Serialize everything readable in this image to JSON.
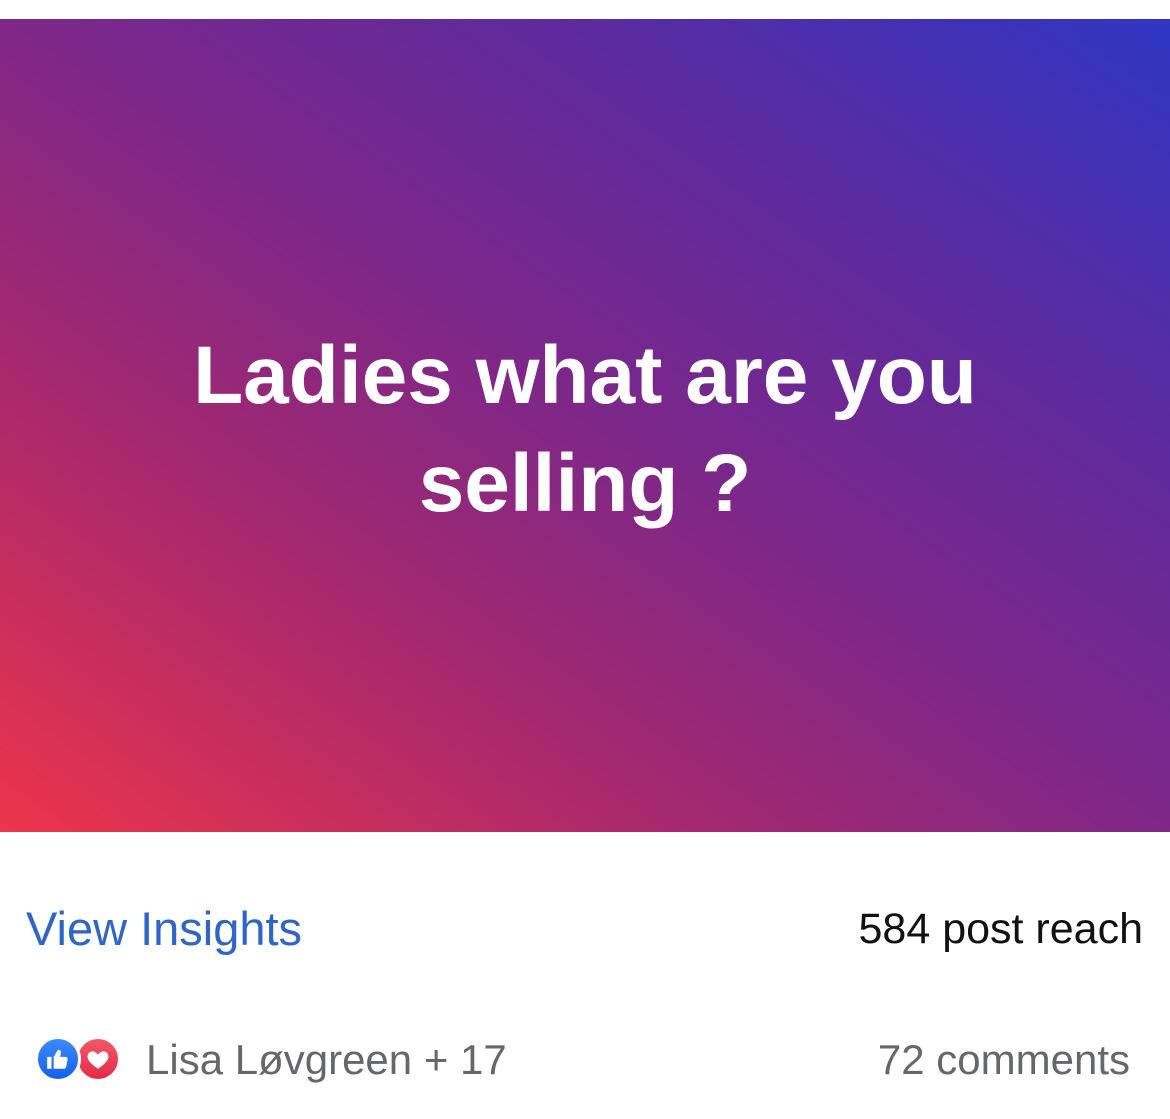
{
  "post": {
    "text": "Ladies what are you selling ?",
    "background_gradient": [
      "#ed344a",
      "#a4286f",
      "#7c278a",
      "#5d2a9e",
      "#2e36c3"
    ]
  },
  "insights": {
    "view_insights_label": "View Insights",
    "post_reach": "584 post reach",
    "link_color": "#2f66c6"
  },
  "reactions": {
    "icons": [
      "like-icon",
      "love-icon"
    ],
    "like_color": "#1877f2",
    "love_color": "#f02849",
    "reactors_label": "Lisa Løvgreen + 17",
    "comments_label": "72 comments"
  }
}
